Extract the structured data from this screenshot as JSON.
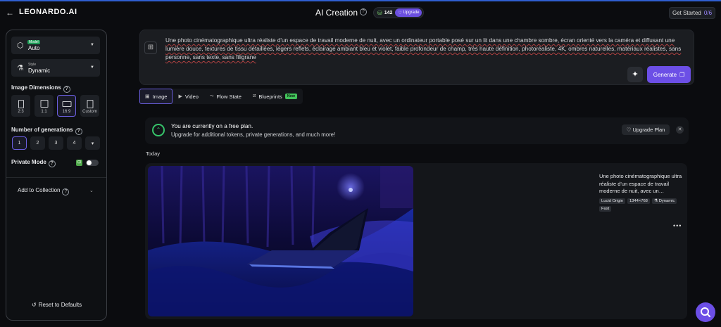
{
  "header": {
    "back_glyph": "←",
    "logo": "LEONARDO.AI",
    "title": "AI Creation",
    "token_count": "142",
    "upgrade_label": "Upgrade",
    "get_started_label": "Get Started",
    "get_started_count": "0/6"
  },
  "panel": {
    "model": {
      "tag": "Model",
      "value": "Auto"
    },
    "style": {
      "label": "Style",
      "value": "Dynamic"
    },
    "image_dimensions_label": "Image Dimensions",
    "dimensions": [
      {
        "label": "2:3"
      },
      {
        "label": "1:1"
      },
      {
        "label": "16:9"
      },
      {
        "label": "Custom"
      }
    ],
    "selected_dimension": "16:9",
    "num_generations_label": "Number of generations",
    "generation_counts": [
      "1",
      "2",
      "3",
      "4"
    ],
    "selected_generation_count": "1",
    "more_caret": "▾",
    "private_mode_label": "Private Mode",
    "private_mode_on": false,
    "add_to_collection_label": "Add to Collection",
    "reset_label": "Reset to Defaults"
  },
  "prompt": {
    "text": "Une photo cinématographique ultra réaliste d'un espace de travail moderne de nuit, avec un ordinateur portable posé sur un lit dans une chambre sombre, écran orienté vers la caméra et diffusant une lumière douce, textures de tissu détaillées, légers reflets, éclairage ambiant bleu et violet, faible profondeur de champ, très haute définition, photoréaliste, 4K, ombres naturelles, matériaux réalistes, sans personne, sans texte, sans filigrane",
    "generate_label": "Generate"
  },
  "tabs": [
    {
      "label": "Image",
      "icon": "image-icon"
    },
    {
      "label": "Video",
      "icon": "video-icon"
    },
    {
      "label": "Flow State",
      "icon": "flow-icon"
    },
    {
      "label": "Blueprints",
      "icon": "blueprint-icon",
      "badge": "New"
    }
  ],
  "banner": {
    "title": "You are currently on a free plan.",
    "subtitle": "Upgrade for additional tokens, private generations, and much more!",
    "upgrade_plan_label": "Upgrade Plan"
  },
  "feed": {
    "section_label": "Today",
    "generation": {
      "description": "Une photo cinématographique ultra réaliste d'un espace de travail moderne de nuit, avec un…",
      "tags": [
        "Lucid Origin",
        "1344×768",
        "Dynamic",
        "Fast"
      ]
    }
  },
  "colors": {
    "accent": "#6c4fe6",
    "success": "#36c46a",
    "background": "#0b0c0f"
  }
}
